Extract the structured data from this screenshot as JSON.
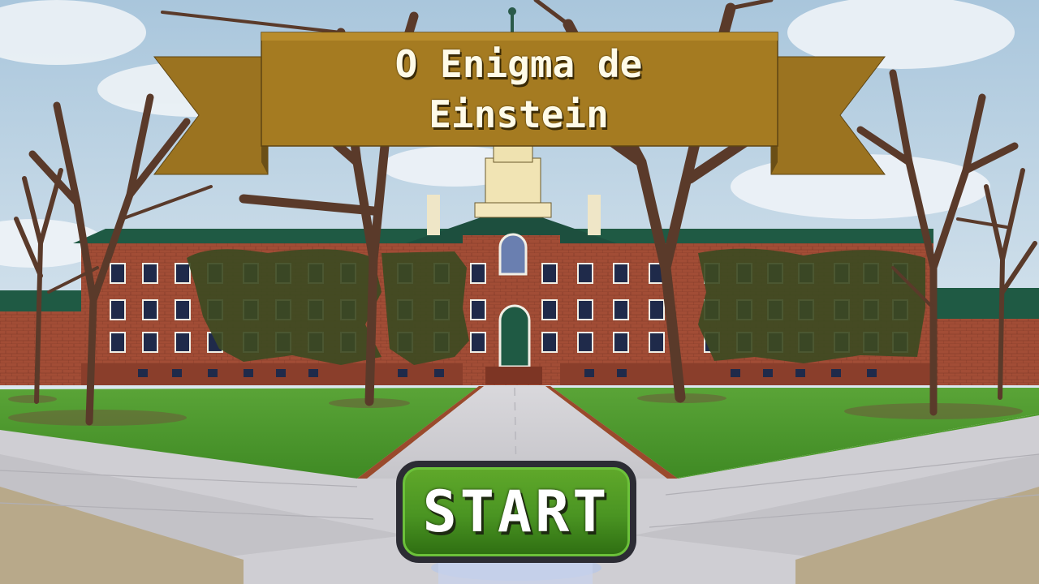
{
  "game": {
    "title_line1": "O Enigma de",
    "title_line2": "Einstein",
    "start_label": "START"
  },
  "colors": {
    "banner_gold": "#a67c1f",
    "button_green": "#4a9422",
    "button_border": "#2c2c34",
    "brick": "#9e4a35",
    "roof": "#1f5a44",
    "grass": "#4f9a2e",
    "sky": "#bfd5e6"
  }
}
